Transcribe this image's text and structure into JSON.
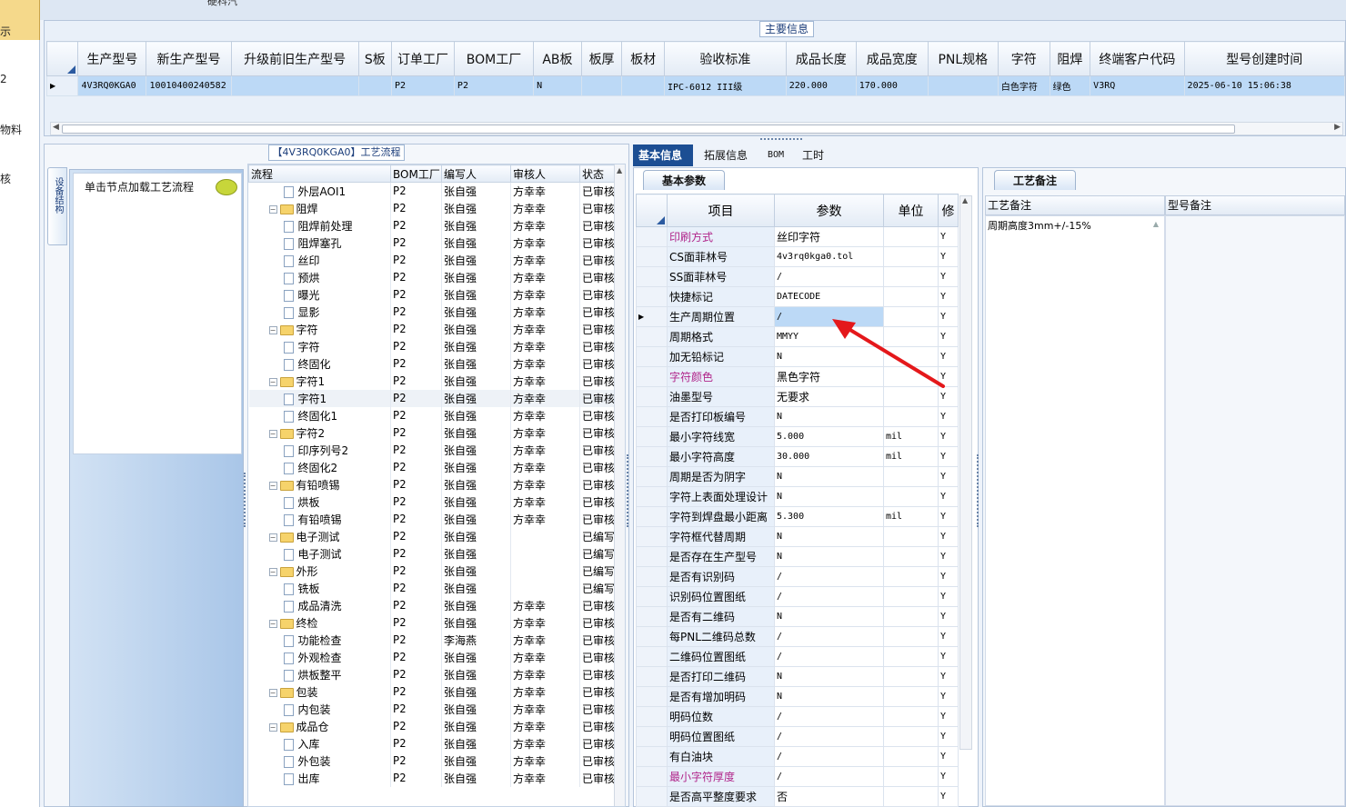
{
  "nav": {
    "items": [
      "示",
      "2",
      "物料",
      "核"
    ]
  },
  "top": {
    "title": "硬科汽"
  },
  "main": {
    "section_title": "主要信息",
    "headers": [
      "生产型号",
      "新生产型号",
      "升级前旧生产型号",
      "S板",
      "订单工厂",
      "BOM工厂",
      "AB板",
      "板厚",
      "板材",
      "验收标准",
      "成品长度",
      "成品宽度",
      "PNL规格",
      "字符",
      "阻焊",
      "终端客户代码",
      "型号创建时间"
    ],
    "row": [
      "4V3RQ0KGA0",
      "10010400240582",
      "",
      "",
      "P2",
      "P2",
      "N",
      "",
      "",
      "IPC-6012 III级",
      "220.000",
      "170.000",
      "",
      "白色字符",
      "绿色",
      "V3RQ",
      "2025-06-10 15:06:38"
    ]
  },
  "process": {
    "section_title": "【4V3RQ0KGA0】工艺流程",
    "side_tab": "设备结构",
    "hint": "单击节点加载工艺流程",
    "headers": [
      "流程",
      "BOM工厂",
      "编写人",
      "审核人",
      "状态"
    ],
    "rows": [
      {
        "name": "外层AOI1",
        "level": 1,
        "type": "doc",
        "bom": "P2",
        "writer": "张自强",
        "reviewer": "方幸幸",
        "status": "已审核"
      },
      {
        "name": "阻焊",
        "level": 0,
        "type": "folder",
        "bom": "P2",
        "writer": "张自强",
        "reviewer": "方幸幸",
        "status": "已审核"
      },
      {
        "name": "阻焊前处理",
        "level": 1,
        "type": "doc",
        "bom": "P2",
        "writer": "张自强",
        "reviewer": "方幸幸",
        "status": "已审核"
      },
      {
        "name": "阻焊塞孔",
        "level": 1,
        "type": "doc",
        "bom": "P2",
        "writer": "张自强",
        "reviewer": "方幸幸",
        "status": "已审核"
      },
      {
        "name": "丝印",
        "level": 1,
        "type": "doc",
        "bom": "P2",
        "writer": "张自强",
        "reviewer": "方幸幸",
        "status": "已审核"
      },
      {
        "name": "预烘",
        "level": 1,
        "type": "doc",
        "bom": "P2",
        "writer": "张自强",
        "reviewer": "方幸幸",
        "status": "已审核"
      },
      {
        "name": "曝光",
        "level": 1,
        "type": "doc",
        "bom": "P2",
        "writer": "张自强",
        "reviewer": "方幸幸",
        "status": "已审核"
      },
      {
        "name": "显影",
        "level": 1,
        "type": "doc",
        "bom": "P2",
        "writer": "张自强",
        "reviewer": "方幸幸",
        "status": "已审核"
      },
      {
        "name": "字符",
        "level": 0,
        "type": "folder",
        "bom": "P2",
        "writer": "张自强",
        "reviewer": "方幸幸",
        "status": "已审核"
      },
      {
        "name": "字符",
        "level": 1,
        "type": "doc",
        "bom": "P2",
        "writer": "张自强",
        "reviewer": "方幸幸",
        "status": "已审核"
      },
      {
        "name": "终固化",
        "level": 1,
        "type": "doc",
        "bom": "P2",
        "writer": "张自强",
        "reviewer": "方幸幸",
        "status": "已审核"
      },
      {
        "name": "字符1",
        "level": 0,
        "type": "folder",
        "bom": "P2",
        "writer": "张自强",
        "reviewer": "方幸幸",
        "status": "已审核"
      },
      {
        "name": "字符1",
        "level": 1,
        "type": "doc",
        "bom": "P2",
        "writer": "张自强",
        "reviewer": "方幸幸",
        "status": "已审核"
      },
      {
        "name": "终固化1",
        "level": 1,
        "type": "doc",
        "bom": "P2",
        "writer": "张自强",
        "reviewer": "方幸幸",
        "status": "已审核"
      },
      {
        "name": "字符2",
        "level": 0,
        "type": "folder",
        "bom": "P2",
        "writer": "张自强",
        "reviewer": "方幸幸",
        "status": "已审核"
      },
      {
        "name": "印序列号2",
        "level": 1,
        "type": "doc",
        "bom": "P2",
        "writer": "张自强",
        "reviewer": "方幸幸",
        "status": "已审核"
      },
      {
        "name": "终固化2",
        "level": 1,
        "type": "doc",
        "bom": "P2",
        "writer": "张自强",
        "reviewer": "方幸幸",
        "status": "已审核"
      },
      {
        "name": "有铅喷锡",
        "level": 0,
        "type": "folder",
        "bom": "P2",
        "writer": "张自强",
        "reviewer": "方幸幸",
        "status": "已审核"
      },
      {
        "name": "烘板",
        "level": 1,
        "type": "doc",
        "bom": "P2",
        "writer": "张自强",
        "reviewer": "方幸幸",
        "status": "已审核"
      },
      {
        "name": "有铅喷锡",
        "level": 1,
        "type": "doc",
        "bom": "P2",
        "writer": "张自强",
        "reviewer": "方幸幸",
        "status": "已审核"
      },
      {
        "name": "电子测试",
        "level": 0,
        "type": "folder",
        "bom": "P2",
        "writer": "张自强",
        "reviewer": "",
        "status": "已编写"
      },
      {
        "name": "电子测试",
        "level": 1,
        "type": "doc",
        "bom": "P2",
        "writer": "张自强",
        "reviewer": "",
        "status": "已编写"
      },
      {
        "name": "外形",
        "level": 0,
        "type": "folder",
        "bom": "P2",
        "writer": "张自强",
        "reviewer": "",
        "status": "已编写"
      },
      {
        "name": "铣板",
        "level": 1,
        "type": "doc",
        "bom": "P2",
        "writer": "张自强",
        "reviewer": "",
        "status": "已编写"
      },
      {
        "name": "成品清洗",
        "level": 1,
        "type": "doc",
        "bom": "P2",
        "writer": "张自强",
        "reviewer": "方幸幸",
        "status": "已审核"
      },
      {
        "name": "终检",
        "level": 0,
        "type": "folder",
        "bom": "P2",
        "writer": "张自强",
        "reviewer": "方幸幸",
        "status": "已审核"
      },
      {
        "name": "功能检查",
        "level": 1,
        "type": "doc",
        "bom": "P2",
        "writer": "李海燕",
        "reviewer": "方幸幸",
        "status": "已审核"
      },
      {
        "name": "外观检查",
        "level": 1,
        "type": "doc",
        "bom": "P2",
        "writer": "张自强",
        "reviewer": "方幸幸",
        "status": "已审核"
      },
      {
        "name": "烘板整平",
        "level": 1,
        "type": "doc",
        "bom": "P2",
        "writer": "张自强",
        "reviewer": "方幸幸",
        "status": "已审核"
      },
      {
        "name": "包装",
        "level": 0,
        "type": "folder",
        "bom": "P2",
        "writer": "张自强",
        "reviewer": "方幸幸",
        "status": "已审核"
      },
      {
        "name": "内包装",
        "level": 1,
        "type": "doc",
        "bom": "P2",
        "writer": "张自强",
        "reviewer": "方幸幸",
        "status": "已审核"
      },
      {
        "name": "成品仓",
        "level": 0,
        "type": "folder",
        "bom": "P2",
        "writer": "张自强",
        "reviewer": "方幸幸",
        "status": "已审核"
      },
      {
        "name": "入库",
        "level": 1,
        "type": "doc",
        "bom": "P2",
        "writer": "张自强",
        "reviewer": "方幸幸",
        "status": "已审核"
      },
      {
        "name": "外包装",
        "level": 1,
        "type": "doc",
        "bom": "P2",
        "writer": "张自强",
        "reviewer": "方幸幸",
        "status": "已审核"
      },
      {
        "name": "出库",
        "level": 1,
        "type": "doc",
        "bom": "P2",
        "writer": "张自强",
        "reviewer": "方幸幸",
        "status": "已审核"
      }
    ]
  },
  "params": {
    "tabs": [
      "基本信息",
      "拓展信息",
      "BOM",
      "工时"
    ],
    "sub_tab": "基本参数",
    "headers": [
      "项目",
      "参数",
      "单位",
      "修"
    ],
    "rows": [
      {
        "k": "印刷方式",
        "v": "丝印字符",
        "u": "",
        "f": "Y",
        "pink": true
      },
      {
        "k": "CS面菲林号",
        "v": "4v3rq0kga0.tol",
        "u": "",
        "f": "Y",
        "pink": false
      },
      {
        "k": "SS面菲林号",
        "v": "/",
        "u": "",
        "f": "Y",
        "pink": false
      },
      {
        "k": "快捷标记",
        "v": "DATECODE",
        "u": "",
        "f": "Y",
        "pink": false
      },
      {
        "k": "生产周期位置",
        "v": "/",
        "u": "",
        "f": "Y",
        "pink": false
      },
      {
        "k": "周期格式",
        "v": "MMYY",
        "u": "",
        "f": "Y",
        "pink": false
      },
      {
        "k": "加无铅标记",
        "v": "N",
        "u": "",
        "f": "Y",
        "pink": false
      },
      {
        "k": "字符颜色",
        "v": "黑色字符",
        "u": "",
        "f": "Y",
        "pink": true
      },
      {
        "k": "油墨型号",
        "v": "无要求",
        "u": "",
        "f": "Y",
        "pink": false
      },
      {
        "k": "是否打印板编号",
        "v": "N",
        "u": "",
        "f": "Y",
        "pink": false
      },
      {
        "k": "最小字符线宽",
        "v": "5.000",
        "u": "mil",
        "f": "Y",
        "pink": false
      },
      {
        "k": "最小字符高度",
        "v": "30.000",
        "u": "mil",
        "f": "Y",
        "pink": false
      },
      {
        "k": "周期是否为阴字",
        "v": "N",
        "u": "",
        "f": "Y",
        "pink": false
      },
      {
        "k": "字符上表面处理设计",
        "v": "N",
        "u": "",
        "f": "Y",
        "pink": false
      },
      {
        "k": "字符到焊盘最小距离",
        "v": "5.300",
        "u": "mil",
        "f": "Y",
        "pink": false
      },
      {
        "k": "字符框代替周期",
        "v": "N",
        "u": "",
        "f": "Y",
        "pink": false
      },
      {
        "k": "是否存在生产型号",
        "v": "N",
        "u": "",
        "f": "Y",
        "pink": false
      },
      {
        "k": "是否有识别码",
        "v": "/",
        "u": "",
        "f": "Y",
        "pink": false
      },
      {
        "k": "识别码位置图纸",
        "v": "/",
        "u": "",
        "f": "Y",
        "pink": false
      },
      {
        "k": "是否有二维码",
        "v": "N",
        "u": "",
        "f": "Y",
        "pink": false
      },
      {
        "k": "每PNL二维码总数",
        "v": "/",
        "u": "",
        "f": "Y",
        "pink": false
      },
      {
        "k": "二维码位置图纸",
        "v": "/",
        "u": "",
        "f": "Y",
        "pink": false
      },
      {
        "k": "是否打印二维码",
        "v": "N",
        "u": "",
        "f": "Y",
        "pink": false
      },
      {
        "k": "是否有增加明码",
        "v": "N",
        "u": "",
        "f": "Y",
        "pink": false
      },
      {
        "k": "明码位数",
        "v": "/",
        "u": "",
        "f": "Y",
        "pink": false
      },
      {
        "k": "明码位置图纸",
        "v": "/",
        "u": "",
        "f": "Y",
        "pink": false
      },
      {
        "k": "有白油块",
        "v": "/",
        "u": "",
        "f": "Y",
        "pink": false
      },
      {
        "k": "最小字符厚度",
        "v": "/",
        "u": "",
        "f": "Y",
        "pink": true
      },
      {
        "k": "是否高平整度要求",
        "v": "否",
        "u": "",
        "f": "Y",
        "pink": false
      }
    ]
  },
  "remarks": {
    "sub_tab": "工艺备注",
    "headers": [
      "工艺备注",
      "型号备注"
    ],
    "process_remark": "周期高度3mm+/-15%",
    "model_remark": ""
  },
  "colors": {
    "selected_row": "#bcd9f6",
    "accent": "#1c4e93",
    "pink": "#b0258a",
    "arrow": "#e4181b"
  }
}
